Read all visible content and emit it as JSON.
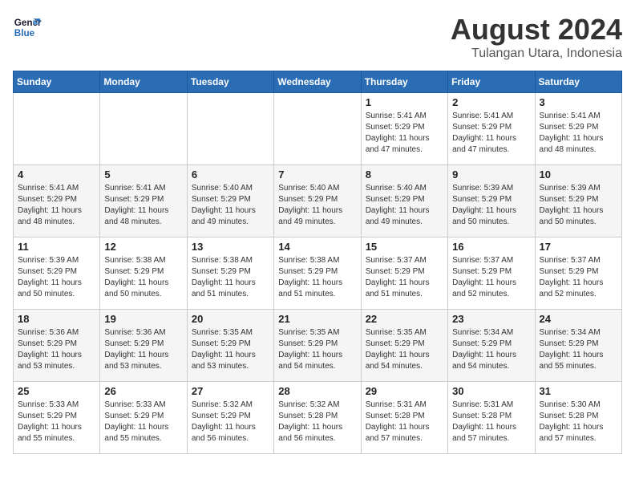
{
  "logo": {
    "line1": "General",
    "line2": "Blue"
  },
  "header": {
    "month_year": "August 2024",
    "location": "Tulangan Utara, Indonesia"
  },
  "weekdays": [
    "Sunday",
    "Monday",
    "Tuesday",
    "Wednesday",
    "Thursday",
    "Friday",
    "Saturday"
  ],
  "weeks": [
    [
      {
        "day": "",
        "info": ""
      },
      {
        "day": "",
        "info": ""
      },
      {
        "day": "",
        "info": ""
      },
      {
        "day": "",
        "info": ""
      },
      {
        "day": "1",
        "info": "Sunrise: 5:41 AM\nSunset: 5:29 PM\nDaylight: 11 hours\nand 47 minutes."
      },
      {
        "day": "2",
        "info": "Sunrise: 5:41 AM\nSunset: 5:29 PM\nDaylight: 11 hours\nand 47 minutes."
      },
      {
        "day": "3",
        "info": "Sunrise: 5:41 AM\nSunset: 5:29 PM\nDaylight: 11 hours\nand 48 minutes."
      }
    ],
    [
      {
        "day": "4",
        "info": "Sunrise: 5:41 AM\nSunset: 5:29 PM\nDaylight: 11 hours\nand 48 minutes."
      },
      {
        "day": "5",
        "info": "Sunrise: 5:41 AM\nSunset: 5:29 PM\nDaylight: 11 hours\nand 48 minutes."
      },
      {
        "day": "6",
        "info": "Sunrise: 5:40 AM\nSunset: 5:29 PM\nDaylight: 11 hours\nand 49 minutes."
      },
      {
        "day": "7",
        "info": "Sunrise: 5:40 AM\nSunset: 5:29 PM\nDaylight: 11 hours\nand 49 minutes."
      },
      {
        "day": "8",
        "info": "Sunrise: 5:40 AM\nSunset: 5:29 PM\nDaylight: 11 hours\nand 49 minutes."
      },
      {
        "day": "9",
        "info": "Sunrise: 5:39 AM\nSunset: 5:29 PM\nDaylight: 11 hours\nand 50 minutes."
      },
      {
        "day": "10",
        "info": "Sunrise: 5:39 AM\nSunset: 5:29 PM\nDaylight: 11 hours\nand 50 minutes."
      }
    ],
    [
      {
        "day": "11",
        "info": "Sunrise: 5:39 AM\nSunset: 5:29 PM\nDaylight: 11 hours\nand 50 minutes."
      },
      {
        "day": "12",
        "info": "Sunrise: 5:38 AM\nSunset: 5:29 PM\nDaylight: 11 hours\nand 50 minutes."
      },
      {
        "day": "13",
        "info": "Sunrise: 5:38 AM\nSunset: 5:29 PM\nDaylight: 11 hours\nand 51 minutes."
      },
      {
        "day": "14",
        "info": "Sunrise: 5:38 AM\nSunset: 5:29 PM\nDaylight: 11 hours\nand 51 minutes."
      },
      {
        "day": "15",
        "info": "Sunrise: 5:37 AM\nSunset: 5:29 PM\nDaylight: 11 hours\nand 51 minutes."
      },
      {
        "day": "16",
        "info": "Sunrise: 5:37 AM\nSunset: 5:29 PM\nDaylight: 11 hours\nand 52 minutes."
      },
      {
        "day": "17",
        "info": "Sunrise: 5:37 AM\nSunset: 5:29 PM\nDaylight: 11 hours\nand 52 minutes."
      }
    ],
    [
      {
        "day": "18",
        "info": "Sunrise: 5:36 AM\nSunset: 5:29 PM\nDaylight: 11 hours\nand 53 minutes."
      },
      {
        "day": "19",
        "info": "Sunrise: 5:36 AM\nSunset: 5:29 PM\nDaylight: 11 hours\nand 53 minutes."
      },
      {
        "day": "20",
        "info": "Sunrise: 5:35 AM\nSunset: 5:29 PM\nDaylight: 11 hours\nand 53 minutes."
      },
      {
        "day": "21",
        "info": "Sunrise: 5:35 AM\nSunset: 5:29 PM\nDaylight: 11 hours\nand 54 minutes."
      },
      {
        "day": "22",
        "info": "Sunrise: 5:35 AM\nSunset: 5:29 PM\nDaylight: 11 hours\nand 54 minutes."
      },
      {
        "day": "23",
        "info": "Sunrise: 5:34 AM\nSunset: 5:29 PM\nDaylight: 11 hours\nand 54 minutes."
      },
      {
        "day": "24",
        "info": "Sunrise: 5:34 AM\nSunset: 5:29 PM\nDaylight: 11 hours\nand 55 minutes."
      }
    ],
    [
      {
        "day": "25",
        "info": "Sunrise: 5:33 AM\nSunset: 5:29 PM\nDaylight: 11 hours\nand 55 minutes."
      },
      {
        "day": "26",
        "info": "Sunrise: 5:33 AM\nSunset: 5:29 PM\nDaylight: 11 hours\nand 55 minutes."
      },
      {
        "day": "27",
        "info": "Sunrise: 5:32 AM\nSunset: 5:29 PM\nDaylight: 11 hours\nand 56 minutes."
      },
      {
        "day": "28",
        "info": "Sunrise: 5:32 AM\nSunset: 5:28 PM\nDaylight: 11 hours\nand 56 minutes."
      },
      {
        "day": "29",
        "info": "Sunrise: 5:31 AM\nSunset: 5:28 PM\nDaylight: 11 hours\nand 57 minutes."
      },
      {
        "day": "30",
        "info": "Sunrise: 5:31 AM\nSunset: 5:28 PM\nDaylight: 11 hours\nand 57 minutes."
      },
      {
        "day": "31",
        "info": "Sunrise: 5:30 AM\nSunset: 5:28 PM\nDaylight: 11 hours\nand 57 minutes."
      }
    ]
  ]
}
